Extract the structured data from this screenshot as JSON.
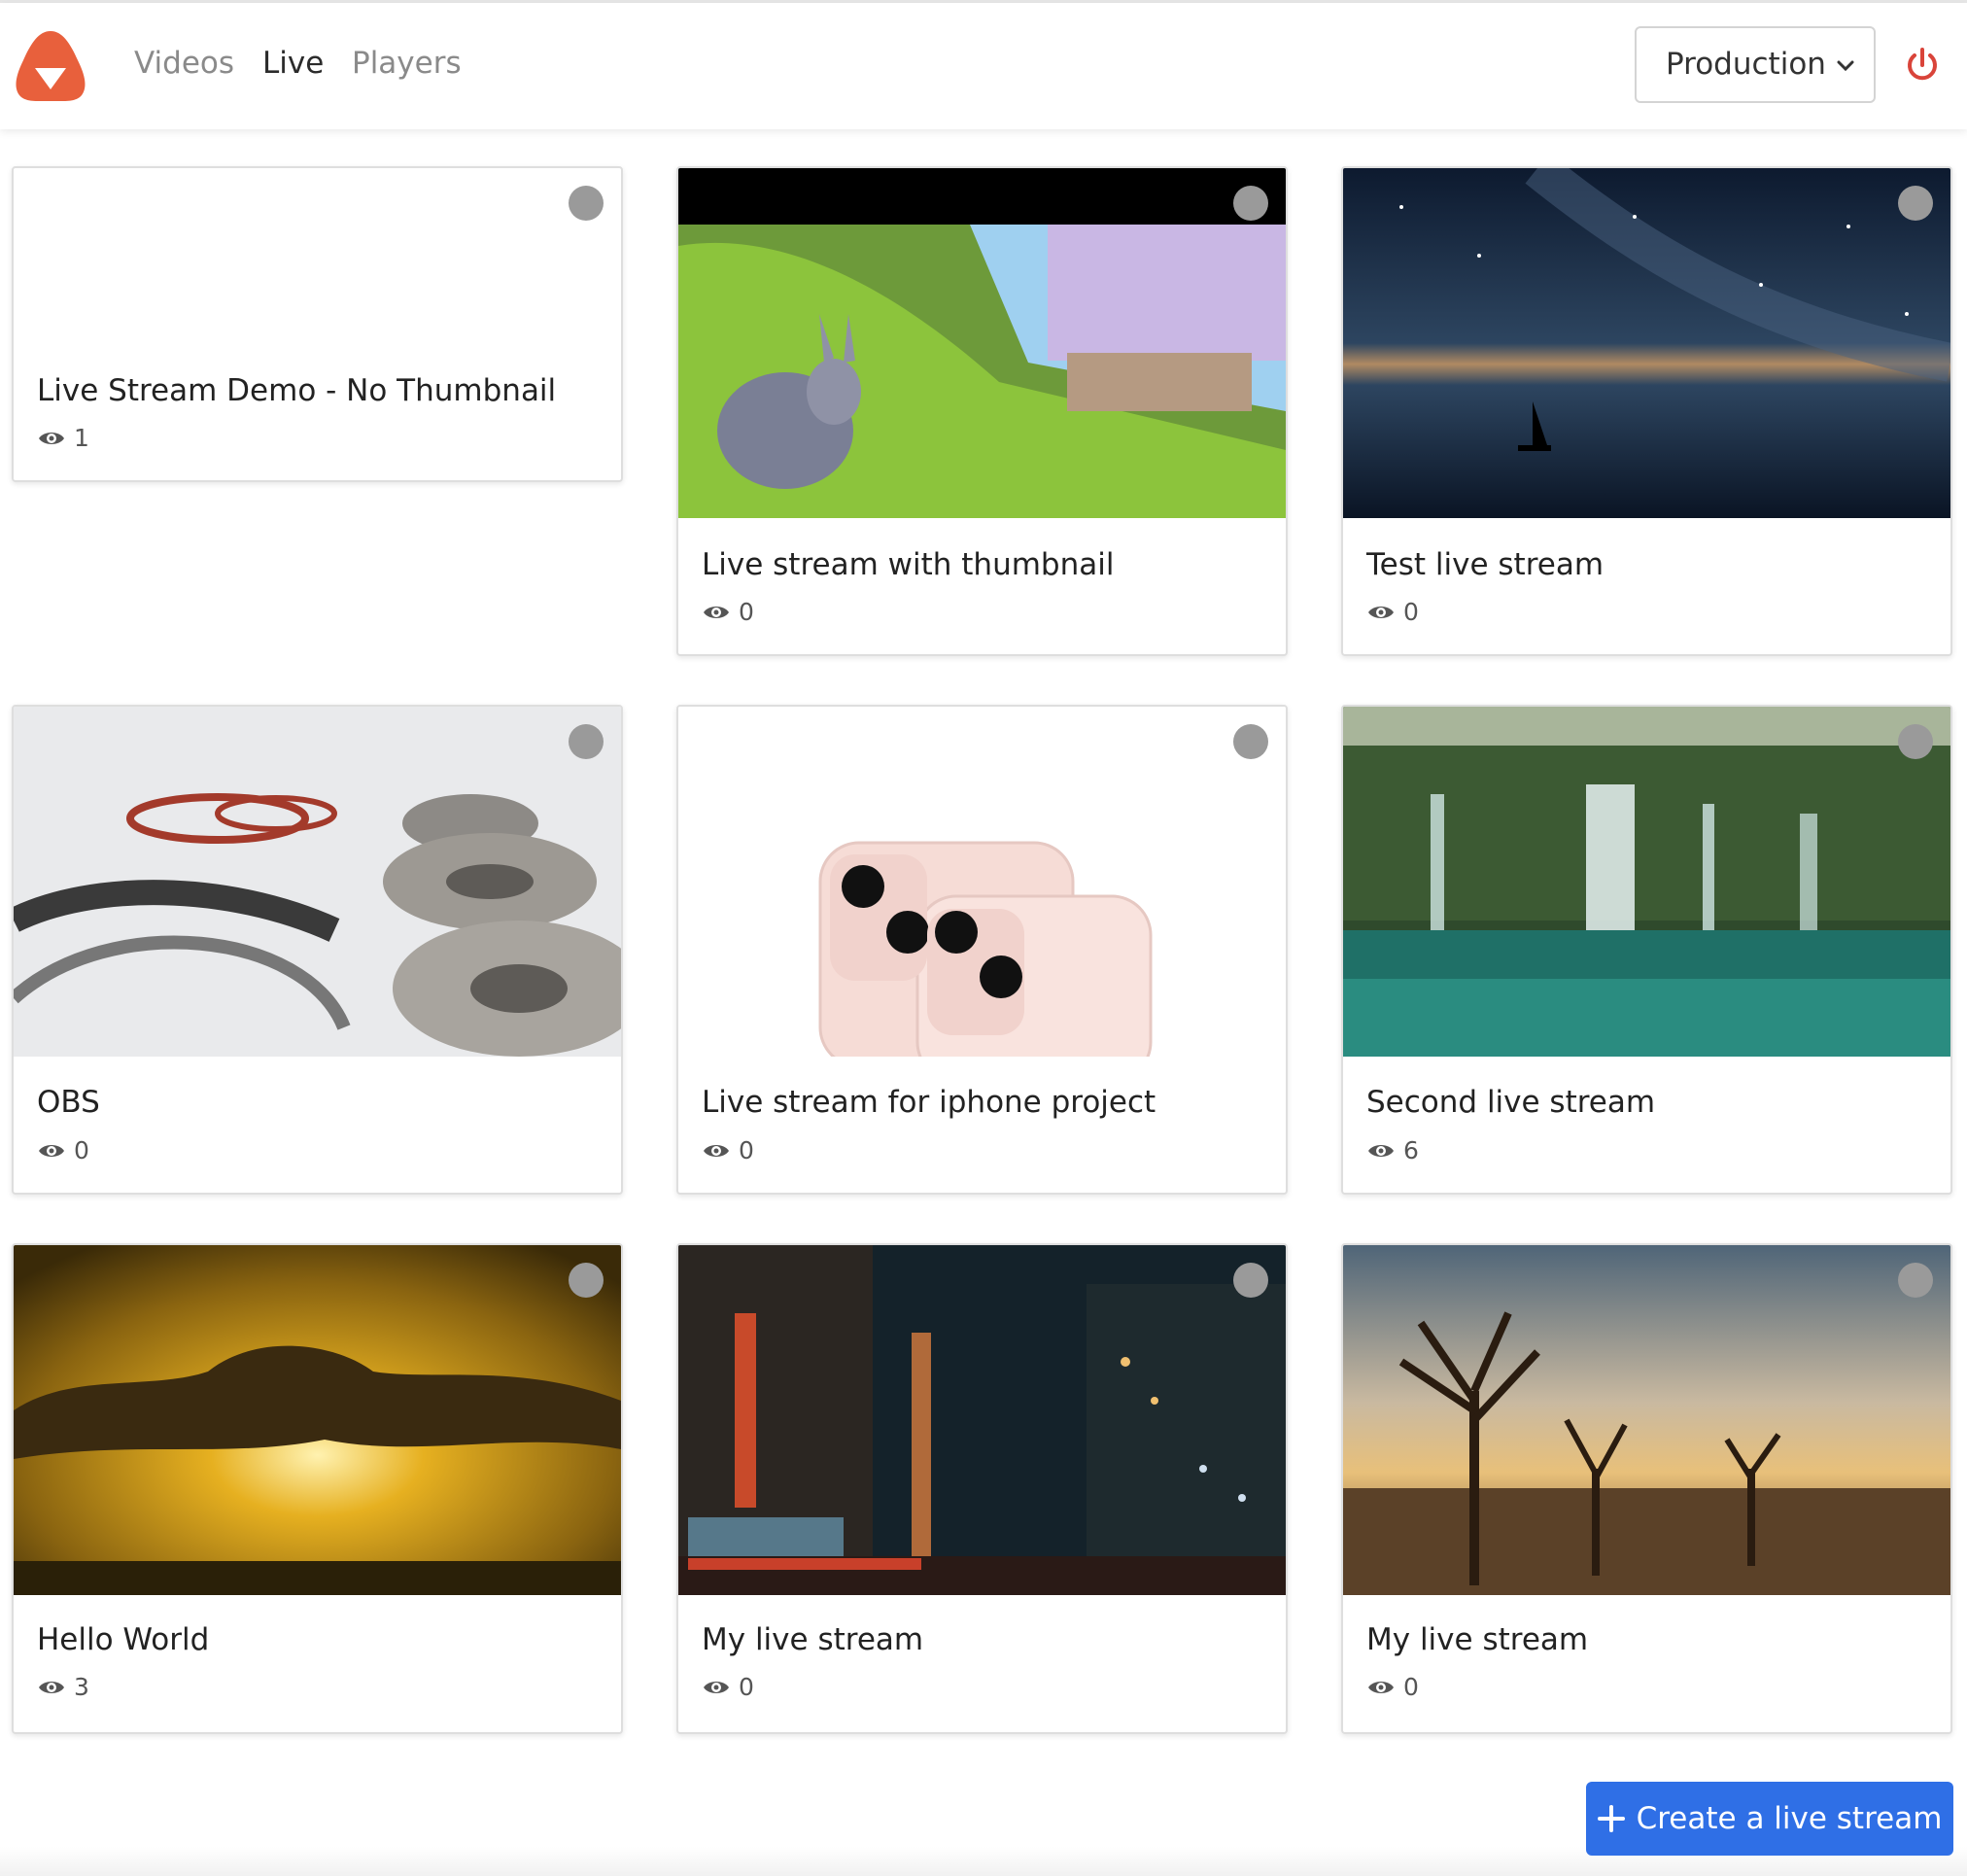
{
  "nav": {
    "links": [
      "Videos",
      "Live",
      "Players"
    ],
    "active": "Live",
    "environment": "Production"
  },
  "colors": {
    "brand": "#e8603c",
    "accent": "#2f6fe6",
    "power": "#d9443a",
    "status_dot": "#9a9a9a"
  },
  "streams": [
    {
      "title": "Live Stream Demo - No Thumbnail",
      "views": "1"
    },
    {
      "title": "Live stream with thumbnail",
      "views": "0"
    },
    {
      "title": "Test live stream",
      "views": "0"
    },
    {
      "title": "OBS",
      "views": "0"
    },
    {
      "title": "Live stream for iphone project",
      "views": "0"
    },
    {
      "title": "Second live stream",
      "views": "6"
    },
    {
      "title": "Hello World",
      "views": "3"
    },
    {
      "title": "My live stream",
      "views": "0"
    },
    {
      "title": "My live stream",
      "views": "0"
    }
  ],
  "actions": {
    "create_label": "Create a live stream"
  }
}
